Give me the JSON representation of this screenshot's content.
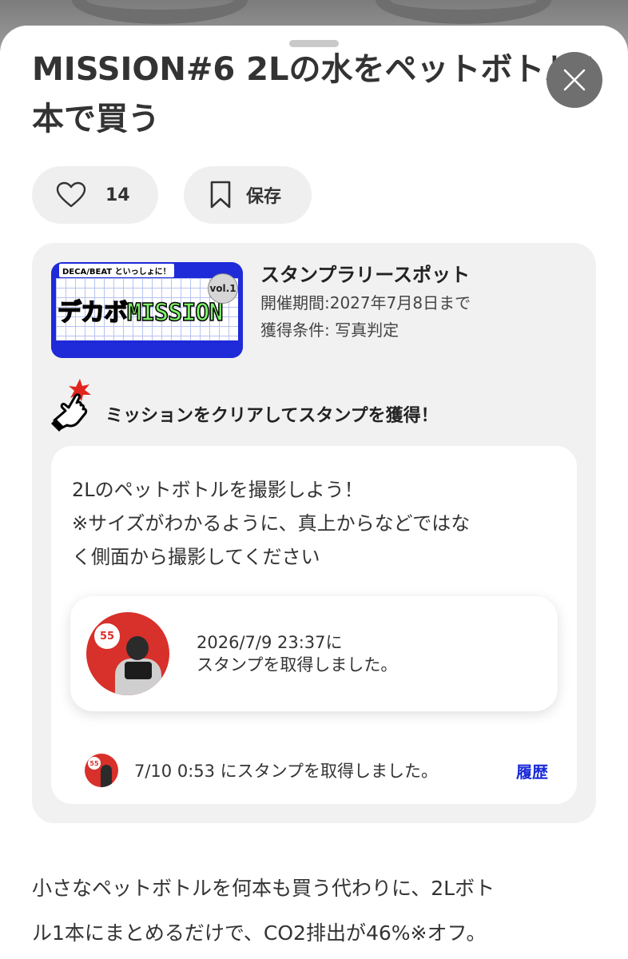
{
  "sheet": {
    "title_line1": "MISSION#6 2Lの水をペットボトル1",
    "title_line2": "本で買う",
    "close_icon": "close-icon"
  },
  "actions": {
    "like_count": "14",
    "save_label": "保存"
  },
  "spot": {
    "banner_top_text": "DECA/BEAT といっしょに！",
    "banner_title": "デカボMISSION",
    "banner_vol": "vol.1",
    "type_label": "スタンプラリースポット",
    "period": "開催期間:2027年7月8日まで",
    "condition": "獲得条件: 写真判定",
    "cta": "ミッションをクリアしてスタンプを獲得！"
  },
  "mission": {
    "description_line1": "2Lのペットボトルを撮影しよう！",
    "description_line2": "※サイズがわかるように、真上からなどではな",
    "description_line3": "く側面から撮影してください",
    "stamp_badge": "55",
    "stamp_time": "2026/7/9 23:37に",
    "stamp_msg": "スタンプを取得しました。",
    "history_text": "7/10 0:53 にスタンプを取得しました。",
    "history_link": "履歴"
  },
  "body": {
    "line1": "小さなペットボトルを何本も買う代わりに、2Lボト",
    "line2": "ル1本にまとめるだけで、CO2排出が46%※オフ。"
  },
  "colors": {
    "accent_blue": "#1a2bd8",
    "stamp_red": "#d8302a",
    "card_bg": "#f1f1f1"
  }
}
